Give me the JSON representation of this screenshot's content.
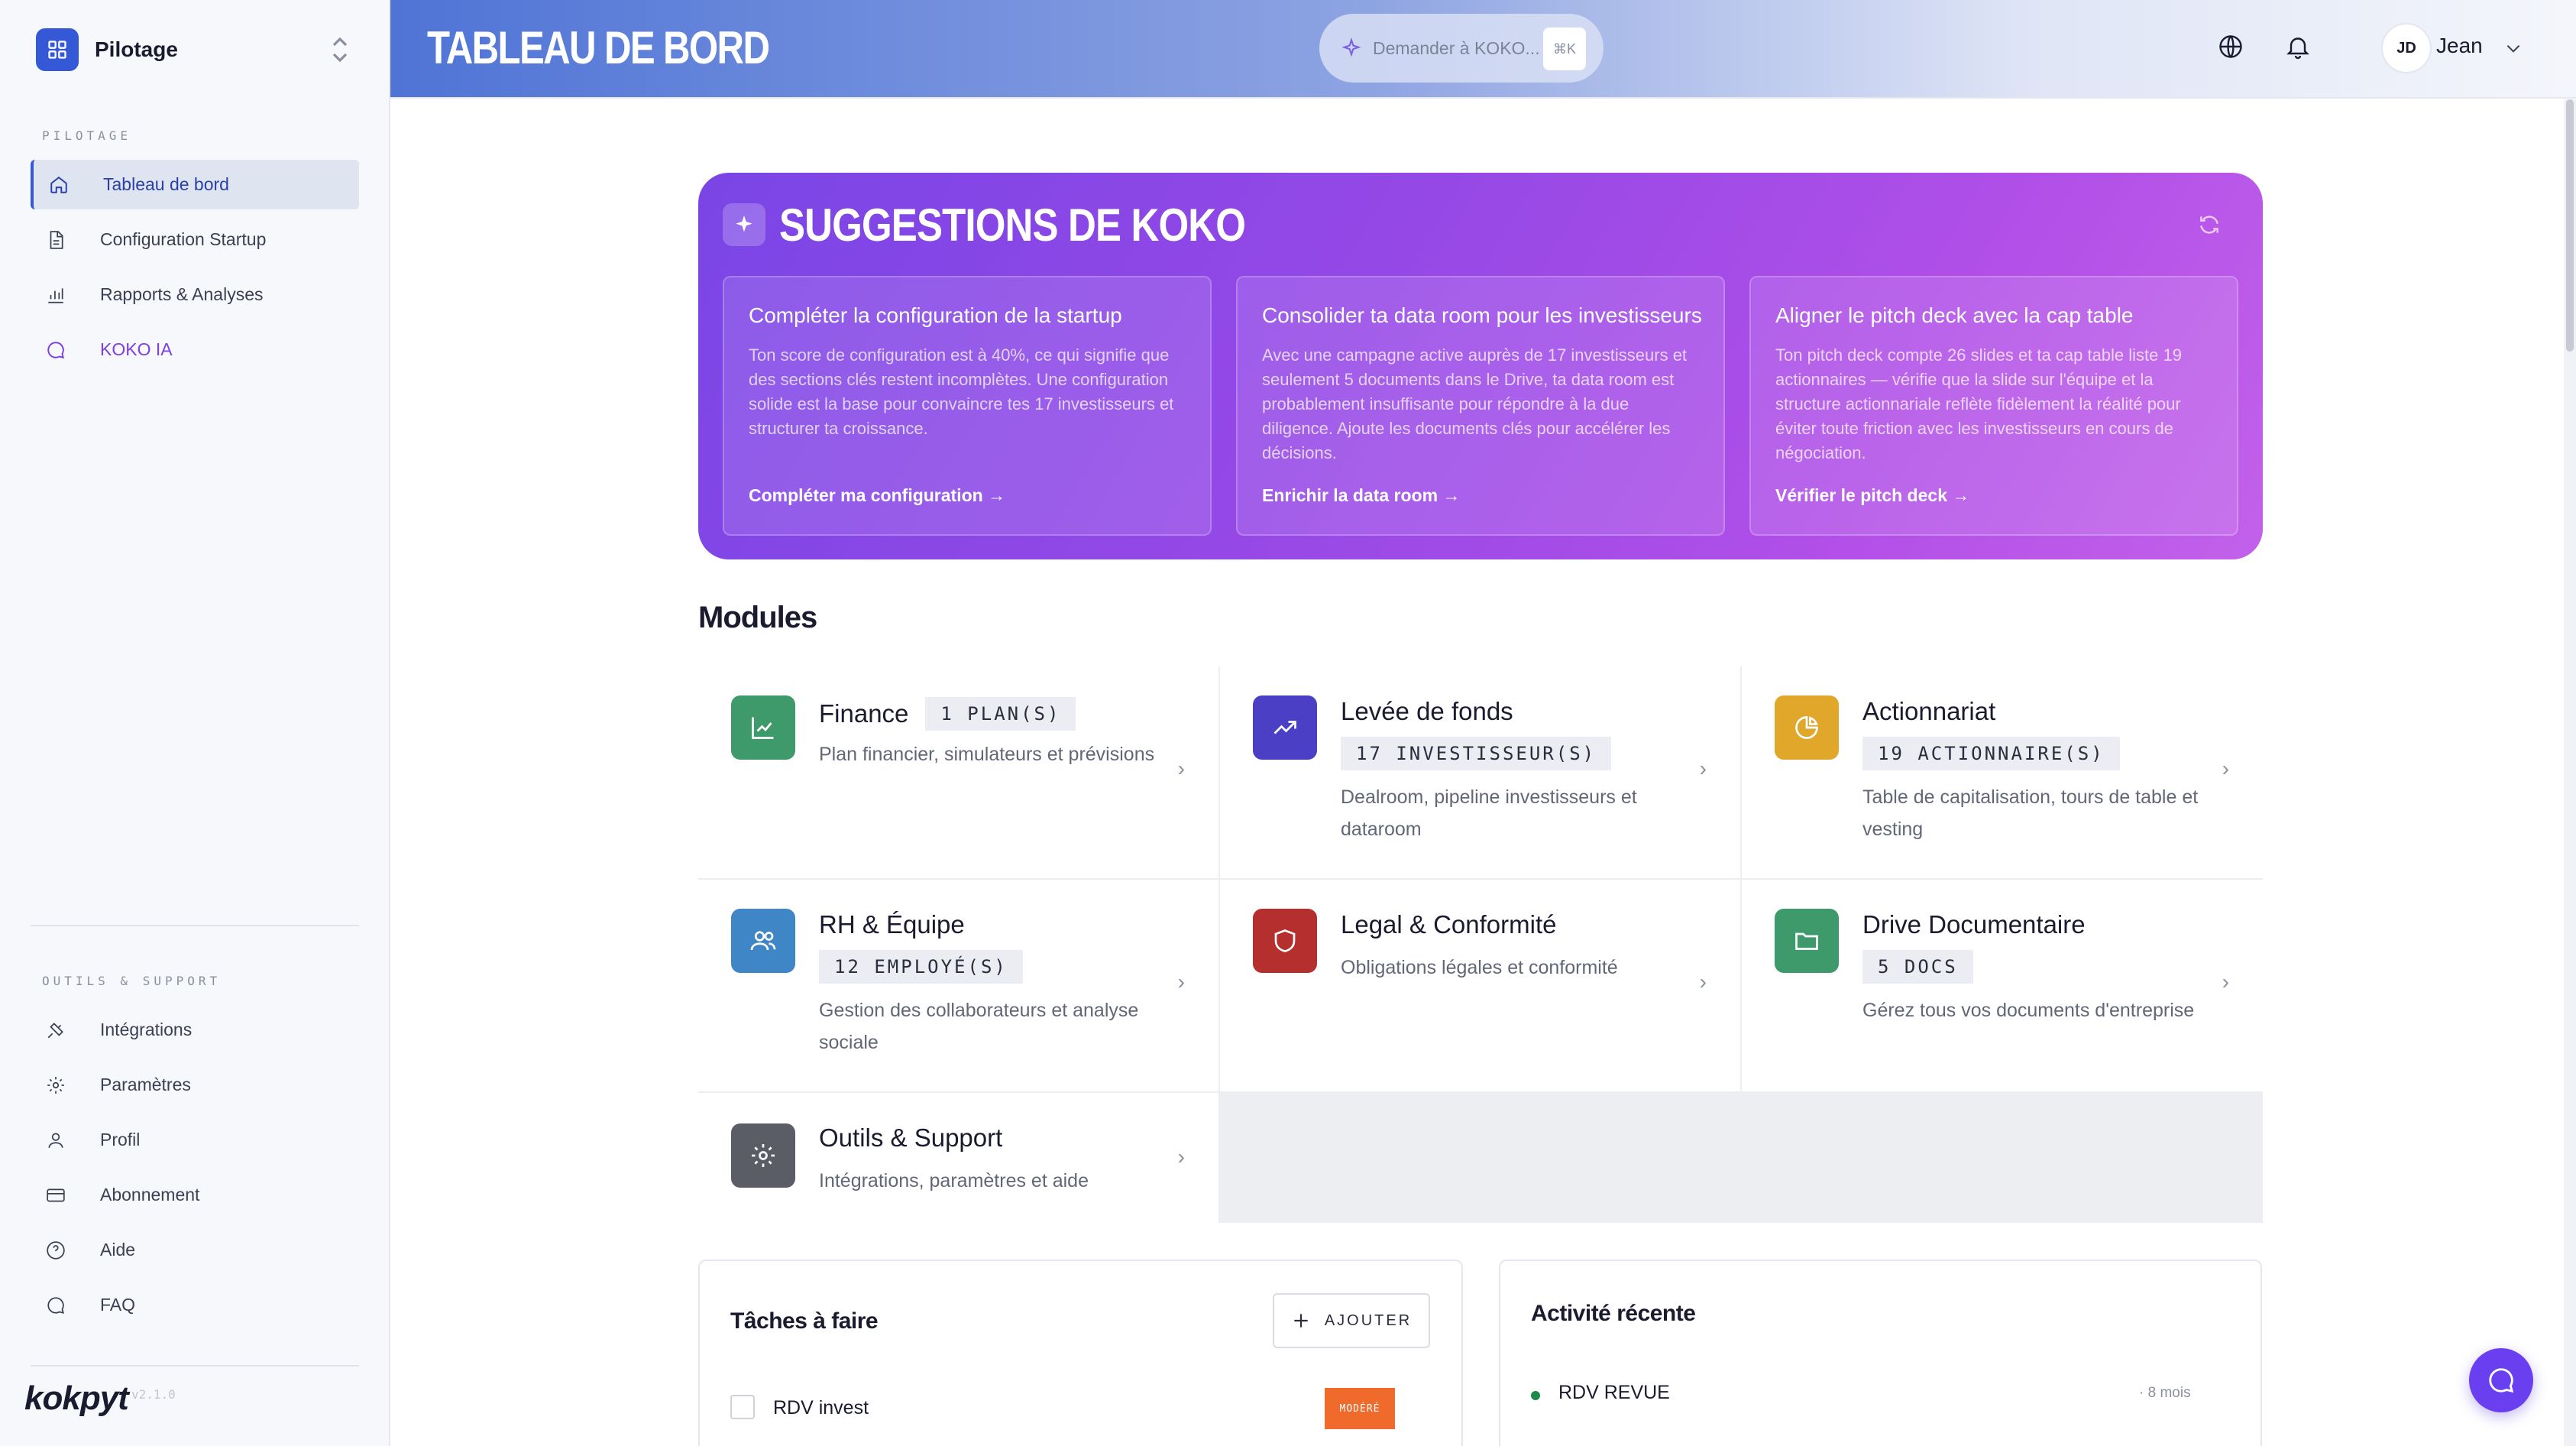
{
  "sidebar": {
    "workspace": "Pilotage",
    "section1": "PILOTAGE",
    "nav": [
      {
        "label": "Tableau de bord",
        "icon": "home-icon"
      },
      {
        "label": "Configuration Startup",
        "icon": "document-icon"
      },
      {
        "label": "Rapports & Analyses",
        "icon": "bar-chart-icon"
      },
      {
        "label": "KOKO IA",
        "icon": "chat-icon"
      }
    ],
    "section2": "OUTILS & SUPPORT",
    "tools": [
      {
        "label": "Intégrations",
        "icon": "plug-icon"
      },
      {
        "label": "Paramètres",
        "icon": "gear-icon"
      },
      {
        "label": "Profil",
        "icon": "user-icon"
      },
      {
        "label": "Abonnement",
        "icon": "credit-card-icon"
      },
      {
        "label": "Aide",
        "icon": "help-icon"
      },
      {
        "label": "FAQ",
        "icon": "chat-icon"
      }
    ],
    "brand": "kokpyt",
    "version": "v2.1.0"
  },
  "header": {
    "title": "TABLEAU DE BORD",
    "ask_label": "Demander à KOKO...",
    "ask_shortcut": "⌘K",
    "user_initials": "JD",
    "user_name": "Jean"
  },
  "koko": {
    "title": "SUGGESTIONS DE KOKO",
    "cards": [
      {
        "title": "Compléter la configuration de la startup",
        "desc": "Ton score de configuration est à 40%, ce qui signifie que des sections clés restent incomplètes. Une configuration solide est la base pour convaincre tes 17 investisseurs et structurer ta croissance.",
        "link": "Compléter ma configuration →"
      },
      {
        "title": "Consolider ta data room pour les investisseurs",
        "desc": "Avec une campagne active auprès de 17 investisseurs et seulement 5 documents dans le Drive, ta data room est probablement insuffisante pour répondre à la due diligence. Ajoute les documents clés pour accélérer les décisions.",
        "link": "Enrichir la data room →"
      },
      {
        "title": "Aligner le pitch deck avec la cap table",
        "desc": "Ton pitch deck compte 26 slides et ta cap table liste 19 actionnaires — vérifie que la slide sur l'équipe et la structure actionnariale reflète fidèlement la réalité pour éviter toute friction avec les investisseurs en cours de négociation.",
        "link": "Vérifier le pitch deck →"
      }
    ]
  },
  "modules": {
    "title": "Modules",
    "items": [
      {
        "name": "Finance",
        "badge": "1 PLAN(S)",
        "desc": "Plan financier, simulateurs et prévisions",
        "color": "#3f9a6b",
        "icon": "line-chart-icon"
      },
      {
        "name": "Levée de fonds",
        "badge": "17 INVESTISSEUR(S)",
        "desc": "Dealroom, pipeline investisseurs et dataroom",
        "color": "#4b3fc6",
        "icon": "trending-up-icon"
      },
      {
        "name": "Actionnariat",
        "badge": "19 ACTIONNAIRE(S)",
        "desc": "Table de capitalisation, tours de table et vesting",
        "color": "#e0a72a",
        "icon": "pie-chart-icon"
      },
      {
        "name": "RH & Équipe",
        "badge": "12 EMPLOYÉ(S)",
        "desc": "Gestion des collaborateurs et analyse sociale",
        "color": "#3f86c6",
        "icon": "users-icon"
      },
      {
        "name": "Legal & Conformité",
        "badge": "",
        "desc": "Obligations légales et conformité",
        "color": "#b52f2f",
        "icon": "shield-icon"
      },
      {
        "name": "Drive Documentaire",
        "badge": "5 DOCS",
        "desc": "Gérez tous vos documents d'entreprise",
        "color": "#3f9a6b",
        "icon": "folder-icon"
      },
      {
        "name": "Outils & Support",
        "badge": "",
        "desc": "Intégrations, paramètres et aide",
        "color": "#5a5d66",
        "icon": "gear-icon"
      }
    ],
    "arrow": "›"
  },
  "tasks": {
    "title": "Tâches à faire",
    "add_label": "AJOUTER",
    "items": [
      {
        "label": "RDV invest",
        "priority": "MODÉRÉ"
      }
    ]
  },
  "activity": {
    "title": "Activité récente",
    "items": [
      {
        "label": "RDV REVUE",
        "time": "· 8 mois"
      }
    ]
  }
}
